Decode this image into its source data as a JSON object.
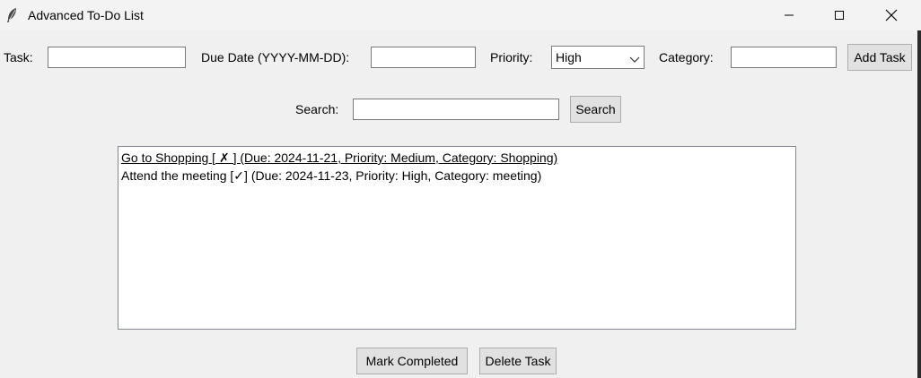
{
  "window": {
    "title": "Advanced To-Do List",
    "icon": "feather-icon",
    "controls": [
      "minimize-icon",
      "maximize-icon",
      "close-icon"
    ]
  },
  "form": {
    "task_label": "Task:",
    "task_value": "",
    "due_label": "Due Date (YYYY-MM-DD):",
    "due_value": "",
    "priority_label": "Priority:",
    "priority_value": "High",
    "category_label": "Category:",
    "category_value": "",
    "add_button": "Add Task"
  },
  "search": {
    "label": "Search:",
    "value": "",
    "button": "Search"
  },
  "tasks": [
    "Go to Shopping [ ✗ ] (Due: 2024-11-21, Priority: Medium, Category: Shopping)",
    "Attend the meeting [✓] (Due: 2024-11-23, Priority: High, Category: meeting)"
  ],
  "actions": {
    "mark_completed": "Mark Completed",
    "delete_task": "Delete Task"
  }
}
